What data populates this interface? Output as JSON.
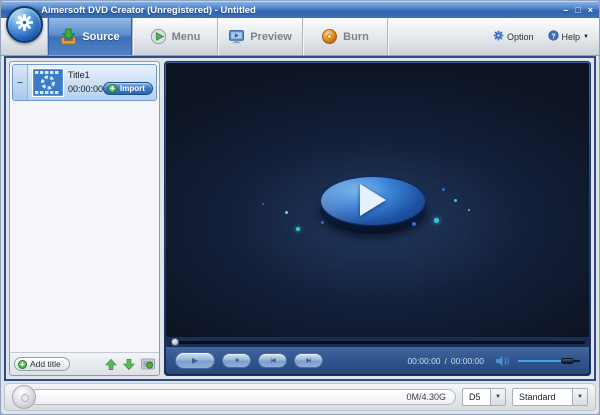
{
  "window": {
    "title": "Aimersoft DVD Creator (Unregistered) - Untitled",
    "controls": {
      "minimize": "–",
      "maximize": "□",
      "close": "×"
    }
  },
  "toolbar": {
    "tabs": [
      {
        "label": "Source",
        "active": true
      },
      {
        "label": "Menu",
        "active": false
      },
      {
        "label": "Preview",
        "active": false
      },
      {
        "label": "Burn",
        "active": false
      }
    ],
    "option_label": "Option",
    "help_label": "Help",
    "help_arrow": "▼"
  },
  "title_panel": {
    "items": [
      {
        "collapse": "–",
        "name": "Title1",
        "duration": "00:00:00",
        "import_label": "Import",
        "plus": "+"
      }
    ],
    "add_title_label": "Add title",
    "add_plus": "+"
  },
  "player": {
    "play_glyph": "▶",
    "stop_glyph": "■",
    "prev_glyph": "|◀",
    "next_glyph": "▶|",
    "time_current": "00:00:00",
    "time_separator": "/",
    "time_total": "00:00:00",
    "volume_percent": 78
  },
  "status_bar": {
    "capacity": "0M/4.30G",
    "disc_type": "D5",
    "quality": "Standard",
    "dropdown_arrow": "▼"
  },
  "colors": {
    "titlebar_blue": "#3a70ba",
    "active_tab_blue": "#4f82c6",
    "control_bar_blue": "#31548c",
    "volume_cyan": "#3da4e8",
    "import_green": "#2f9e2f",
    "burn_orange": "#e8821e"
  }
}
